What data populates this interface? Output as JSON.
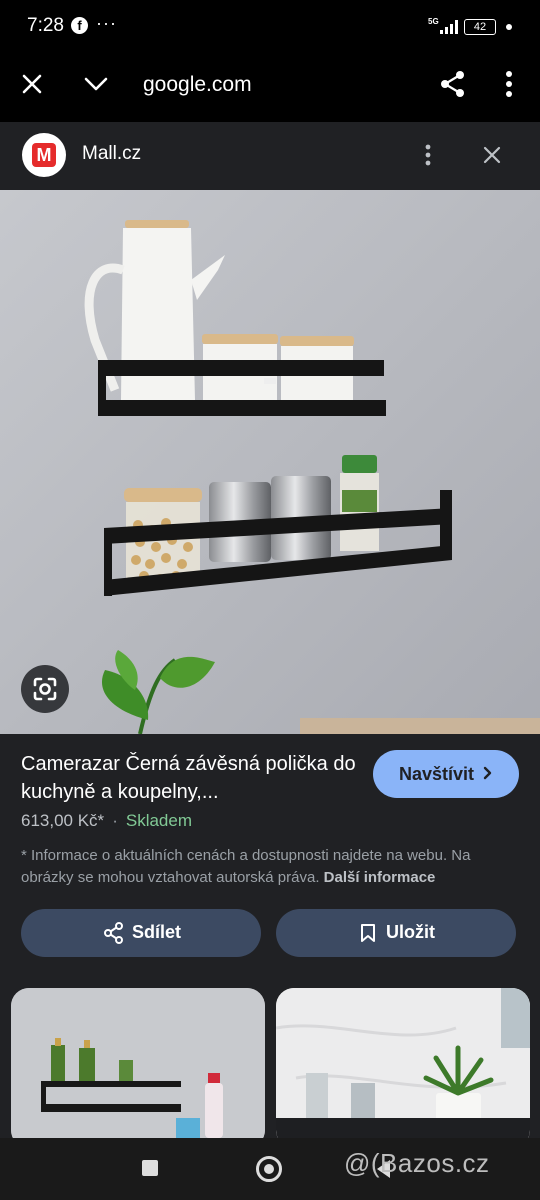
{
  "status_bar": {
    "time": "7:28",
    "facebook_icon": "f",
    "overflow": "···",
    "network": "5G",
    "battery": "42"
  },
  "browser": {
    "url": "google.com"
  },
  "source": {
    "logo_letter": "M",
    "name": "Mall.cz"
  },
  "product": {
    "title": "Camerazar Černá závěsná polička do kuchyně a koupelny,...",
    "visit_label": "Navštívit",
    "price": "613,00 Kč*",
    "separator": "·",
    "availability": "Skladem",
    "disclaimer": "* Informace o aktuálních cenách a dostupnosti najdete na webu. Na obrázky se mohou vztahovat autorská práva.",
    "more_info": "Další informace"
  },
  "actions": {
    "share_label": "Sdílet",
    "save_label": "Uložit"
  },
  "watermark": "@(Bazos.cz"
}
